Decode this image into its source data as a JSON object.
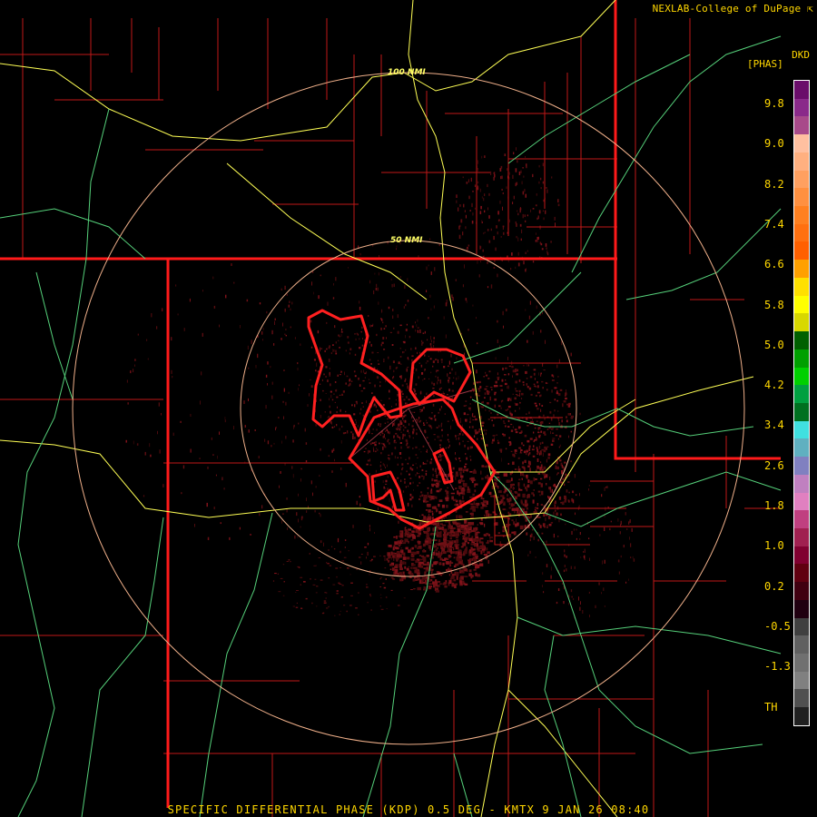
{
  "credit": "NEXLAB-College of DuPage",
  "credit_icon": "external-link-icon",
  "legend": {
    "product": "DKD",
    "units": "[PHAS]",
    "ticks": [
      "9.8",
      "9.0",
      "8.2",
      "7.4",
      "6.6",
      "5.8",
      "5.0",
      "4.2",
      "3.4",
      "2.6",
      "1.8",
      "1.0",
      "0.2",
      "-0.5",
      "-1.3",
      "TH"
    ],
    "colors": [
      "#6a0d6a",
      "#8a2a8a",
      "#a84a8a",
      "#ffc0a0",
      "#ffb080",
      "#ffa060",
      "#ff9040",
      "#ff8020",
      "#ff7010",
      "#ff6000",
      "#ffa000",
      "#ffe000",
      "#ffff00",
      "#d8d800",
      "#006000",
      "#00a000",
      "#00d000",
      "#00a040",
      "#007020",
      "#40e0e0",
      "#60b0c0",
      "#8080c0",
      "#c080c0",
      "#e080c0",
      "#c04080",
      "#a02050",
      "#800030",
      "#600010",
      "#400010",
      "#200010",
      "#404040",
      "#606060",
      "#707070",
      "#808080",
      "#505050",
      "#202020"
    ]
  },
  "rings": {
    "inner_label": "50 NMI",
    "outer_label": "100 NMI"
  },
  "footer": "SPECIFIC DIFFERENTIAL PHASE (KDP) 0.5 DEG - KMTX 9 JAN 26 08:40"
}
